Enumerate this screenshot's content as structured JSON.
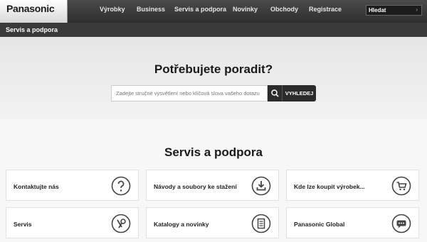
{
  "brand": {
    "logo": "Panasonic"
  },
  "nav": {
    "items": [
      {
        "label": "Výrobky"
      },
      {
        "label": "Business"
      },
      {
        "label": "Servis a podpora"
      },
      {
        "label": "Novinky"
      },
      {
        "label": "Obchody"
      },
      {
        "label": "Registrace"
      }
    ],
    "search_label": "Hledat",
    "search_arrow": "›"
  },
  "breadcrumb": {
    "label": "Servis a podpora"
  },
  "hero": {
    "title": "Potřebujete poradit?",
    "search_placeholder": "Zadejte stručné vysvětlení nebo klíčová slova vašeho dotazu",
    "search_button": "VYHLEDEJ"
  },
  "section": {
    "title": "Servis a podpora",
    "cards": [
      {
        "label": "Kontaktujte nás",
        "icon": "question-icon"
      },
      {
        "label": "Návody a soubory ke stažení",
        "icon": "download-icon"
      },
      {
        "label": "Kde lze koupit výrobek...",
        "icon": "cart-icon"
      },
      {
        "label": "Servis",
        "icon": "tools-icon"
      },
      {
        "label": "Katalogy a novinky",
        "icon": "document-icon"
      },
      {
        "label": "Panasonic Global",
        "icon": "chat-icon"
      }
    ]
  },
  "colors": {
    "nav_bg": "#3a3a3a",
    "accent_dark": "#2b2b2b",
    "icon_stroke": "#444444"
  }
}
